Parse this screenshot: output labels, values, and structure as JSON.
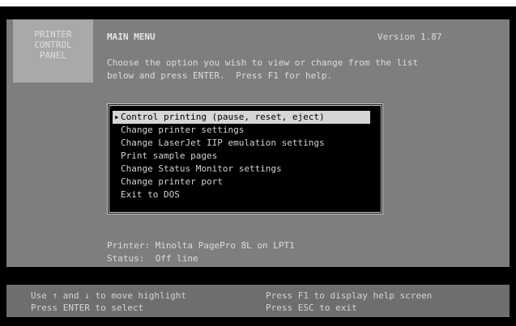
{
  "logo": {
    "line1": "PRINTER",
    "line2": "CONTROL",
    "line3": "PANEL"
  },
  "header": {
    "title": "MAIN MENU",
    "version": "Version 1.87"
  },
  "instructions": {
    "line1": "Choose the option you wish to view or change from the list",
    "line2": "below and press ENTER.  Press F1 for help."
  },
  "menu": {
    "selected_index": 0,
    "items": [
      {
        "label": "Control printing (pause, reset, eject)"
      },
      {
        "label": "Change printer settings"
      },
      {
        "label": "Change LaserJet IIP emulation settings"
      },
      {
        "label": "Print sample pages"
      },
      {
        "label": "Change Status Monitor settings"
      },
      {
        "label": "Change printer port"
      },
      {
        "label": "Exit to DOS"
      }
    ]
  },
  "status": {
    "printer": "Printer: Minolta PagePro 8L on LPT1",
    "state": "Status:  Off line"
  },
  "help": {
    "left_line1": "Use ↑ and ↓ to move highlight",
    "left_line2": "Press ENTER to select",
    "right_line1": "Press F1 to display help screen",
    "right_line2": "Press ESC to exit"
  },
  "colors": {
    "background": "#7e7e7e",
    "logo_box": "#a9a9a9",
    "menu_box": "#000000",
    "highlight": "#d6d6d6",
    "help_bar": "#6e6e6e"
  }
}
